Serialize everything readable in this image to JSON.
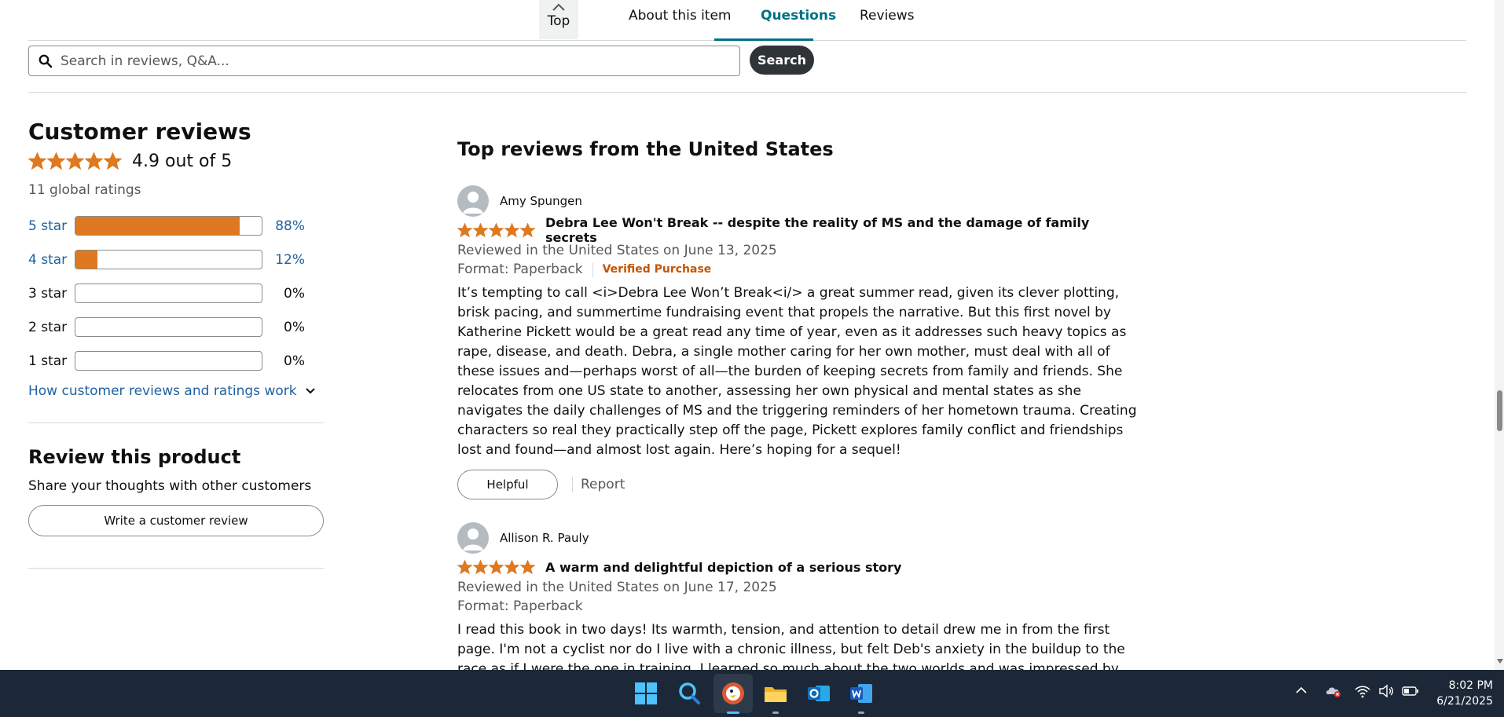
{
  "nav": {
    "top_label": "Top",
    "tabs": [
      {
        "label": "About this item"
      },
      {
        "label": "Questions"
      },
      {
        "label": "Reviews"
      }
    ]
  },
  "search": {
    "placeholder": "Search in reviews, Q&A...",
    "button_label": "Search"
  },
  "customer_reviews": {
    "title": "Customer reviews",
    "rating_text": "4.9 out of 5",
    "stars": 4.9,
    "global_ratings": "11 global ratings",
    "histogram": [
      {
        "label": "5 star",
        "percent_text": "88%",
        "fill": 0.88
      },
      {
        "label": "4 star",
        "percent_text": "12%",
        "fill": 0.12
      },
      {
        "label": "3 star",
        "percent_text": "0%",
        "fill": 0
      },
      {
        "label": "2 star",
        "percent_text": "0%",
        "fill": 0
      },
      {
        "label": "1 star",
        "percent_text": "0%",
        "fill": 0
      }
    ],
    "how_link": "How customer reviews and ratings work"
  },
  "review_product": {
    "title": "Review this product",
    "subtitle": "Share your thoughts with other customers",
    "button_label": "Write a customer review"
  },
  "top_reviews": {
    "title": "Top reviews from the United States",
    "reviews": [
      {
        "name": "Amy Spungen",
        "stars": 5,
        "title": "Debra Lee Won't Break -- despite the reality of MS and the damage of family secrets",
        "date": "Reviewed in the United States on June 13, 2025",
        "format": "Format: Paperback",
        "verified": "Verified Purchase",
        "body": "It’s tempting to call <i>Debra Lee Won’t Break<i/> a great summer read, given its clever plotting, brisk pacing, and summertime fundraising event that propels the narrative. But this first novel by Katherine Pickett would be a great read any time of year, even as it addresses such heavy topics as rape, disease, and death. Debra, a single mother caring for her own mother, must deal with all of these issues and—perhaps worst of all—the burden of keeping secrets from family and friends. She relocates from one US state to another, assessing her own physical and mental states as she navigates the daily challenges of MS and the triggering reminders of her hometown trauma. Creating characters so real they practically step off the page, Pickett explores family conflict and friendships lost and found—and almost lost again. Here’s hoping for a sequel!",
        "helpful_label": "Helpful",
        "report_label": "Report"
      },
      {
        "name": "Allison R. Pauly",
        "stars": 5,
        "title": "A warm and delightful depiction of a serious story",
        "date": "Reviewed in the United States on June 17, 2025",
        "format": "Format: Paperback",
        "body": "I read this book in two days! Its warmth, tension, and attention to detail drew me in from the first page. I'm not a cyclist nor do I live with a chronic illness, but felt Deb's anxiety in the buildup to the race as if I were the one in training. I learned so much about the two worlds and was impressed by the author's careful"
      }
    ]
  },
  "colors": {
    "star": "#de7921",
    "link": "#2162a1",
    "active_tab": "#007185",
    "verified": "#c45500",
    "taskbar": "#1c2837"
  },
  "taskbar": {
    "icons": [
      "windows-start-icon",
      "search-icon",
      "duckduckgo-browser-icon",
      "file-explorer-icon",
      "outlook-icon",
      "word-icon"
    ],
    "time": "8:02 PM",
    "date": "6/21/2025"
  }
}
